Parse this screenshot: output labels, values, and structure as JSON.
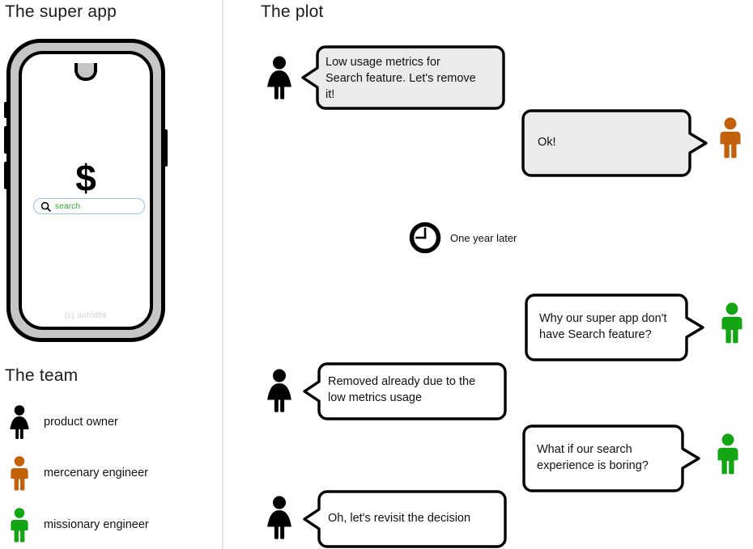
{
  "panels": {
    "left_title": "The super app",
    "team_title": "The team",
    "right_title": "The plot"
  },
  "phone": {
    "app_symbol": "$",
    "search": {
      "placeholder": "search",
      "icon": "search-icon",
      "text_color": "#2ea82e",
      "border_color": "#9dc0ea"
    },
    "watermark": "(c) anhldbk",
    "frame_color": "#c6c6c6",
    "outline_color": "#000000"
  },
  "team": {
    "members": [
      {
        "label": "product owner",
        "figure": "female",
        "color": "#000000"
      },
      {
        "label": "mercenary engineer",
        "figure": "male",
        "color": "#c2610a"
      },
      {
        "label": "missionary engineer",
        "figure": "male",
        "color": "#13a513"
      }
    ]
  },
  "plot": {
    "messages": [
      {
        "speaker": "product owner",
        "figure": "female",
        "color": "#000000",
        "side": "left",
        "fill": "#ebebeb",
        "text": "Low usage metrics for\nSearch feature. Let's remove\nit!"
      },
      {
        "speaker": "mercenary engineer",
        "figure": "male",
        "color": "#c2610a",
        "side": "right",
        "fill": "#ebebeb",
        "text": "Ok!"
      },
      {
        "speaker": "missionary engineer",
        "figure": "male",
        "color": "#13a513",
        "side": "right",
        "fill": "#ffffff",
        "text": "Why our super app don't\nhave Search feature?"
      },
      {
        "speaker": "product owner",
        "figure": "female",
        "color": "#000000",
        "side": "left",
        "fill": "#ffffff",
        "text": "Removed already due to the\nlow metrics usage"
      },
      {
        "speaker": "missionary engineer",
        "figure": "male",
        "color": "#13a513",
        "side": "right",
        "fill": "#ffffff",
        "text": "What if our search\nexperience is boring?"
      },
      {
        "speaker": "product owner",
        "figure": "female",
        "color": "#000000",
        "side": "left",
        "fill": "#ffffff",
        "text": "Oh, let's revisit the decision"
      }
    ],
    "timeskip": {
      "icon": "clock-icon",
      "label": "One year later"
    }
  }
}
